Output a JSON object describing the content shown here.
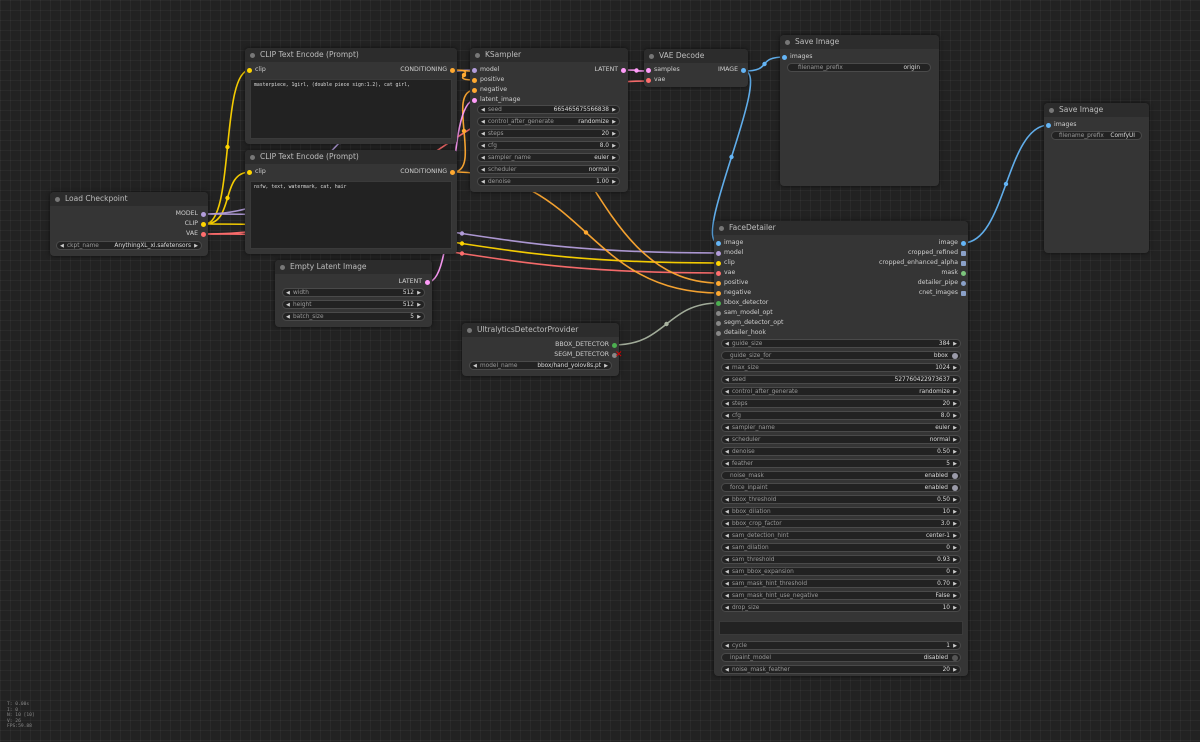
{
  "colors": {
    "model": "#b39ddb",
    "clip": "#ffd500",
    "vae": "#ff6e6e",
    "conditioning": "#ffa931",
    "latent": "#ff9cf9",
    "image": "#64b5f6",
    "bbox": "#4caf50",
    "generic": "#888888"
  },
  "load_checkpoint": {
    "title": "Load Checkpoint",
    "outputs": [
      "MODEL",
      "CLIP",
      "VAE"
    ],
    "ckpt_label": "ckpt_name",
    "ckpt_value": "AnythingXL_xl.safetensors"
  },
  "clip_pos": {
    "title": "CLIP Text Encode (Prompt)",
    "input": "clip",
    "output": "CONDITIONING",
    "text": "masterpiece, 1girl, (double piece sign:1.2), cat girl,"
  },
  "clip_neg": {
    "title": "CLIP Text Encode (Prompt)",
    "input": "clip",
    "output": "CONDITIONING",
    "text": "nsfw, text, watermark, cat, hair"
  },
  "empty_latent": {
    "title": "Empty Latent Image",
    "output": "LATENT",
    "widgets": [
      {
        "label": "width",
        "value": "512"
      },
      {
        "label": "height",
        "value": "512"
      },
      {
        "label": "batch_size",
        "value": "5"
      }
    ]
  },
  "ksampler": {
    "title": "KSampler",
    "inputs": [
      "model",
      "positive",
      "negative",
      "latent_image"
    ],
    "output": "LATENT",
    "widgets": [
      {
        "label": "seed",
        "value": "665465675566838"
      },
      {
        "label": "control_after_generate",
        "value": "randomize"
      },
      {
        "label": "steps",
        "value": "20"
      },
      {
        "label": "cfg",
        "value": "8.0"
      },
      {
        "label": "sampler_name",
        "value": "euler"
      },
      {
        "label": "scheduler",
        "value": "normal"
      },
      {
        "label": "denoise",
        "value": "1.00"
      }
    ]
  },
  "vae_decode": {
    "title": "VAE Decode",
    "inputs": [
      "samples",
      "vae"
    ],
    "output": "IMAGE"
  },
  "save1": {
    "title": "Save Image",
    "input": "images",
    "prefix_label": "filename_prefix",
    "prefix_value": "origin"
  },
  "save2": {
    "title": "Save Image",
    "input": "images",
    "prefix_label": "filename_prefix",
    "prefix_value": "ComfyUI"
  },
  "ultralytics": {
    "title": "UltralyticsDetectorProvider",
    "outputs": [
      "BBOX_DETECTOR",
      "SEGM_DETECTOR"
    ],
    "model_label": "model_name",
    "model_value": "bbox/hand_yolov8s.pt"
  },
  "face_detailer": {
    "title": "FaceDetailer",
    "inputs": [
      "image",
      "model",
      "clip",
      "vae",
      "positive",
      "negative",
      "bbox_detector",
      "sam_model_opt",
      "segm_detector_opt",
      "detailer_hook"
    ],
    "outputs": [
      "image",
      "cropped_refined",
      "cropped_enhanced_alpha",
      "mask",
      "detailer_pipe",
      "cnet_images"
    ],
    "widgets": [
      {
        "label": "guide_size",
        "value": "384",
        "kind": "num"
      },
      {
        "label": "guide_size_for",
        "value": "bbox",
        "kind": "toggle"
      },
      {
        "label": "max_size",
        "value": "1024",
        "kind": "num"
      },
      {
        "label": "seed",
        "value": "527760422973637",
        "kind": "num"
      },
      {
        "label": "control_after_generate",
        "value": "randomize",
        "kind": "num"
      },
      {
        "label": "steps",
        "value": "20",
        "kind": "num"
      },
      {
        "label": "cfg",
        "value": "8.0",
        "kind": "num"
      },
      {
        "label": "sampler_name",
        "value": "euler",
        "kind": "num"
      },
      {
        "label": "scheduler",
        "value": "normal",
        "kind": "num"
      },
      {
        "label": "denoise",
        "value": "0.50",
        "kind": "num"
      },
      {
        "label": "feather",
        "value": "5",
        "kind": "num"
      },
      {
        "label": "noise_mask",
        "value": "enabled",
        "kind": "toggle"
      },
      {
        "label": "force_inpaint",
        "value": "enabled",
        "kind": "toggle"
      },
      {
        "label": "bbox_threshold",
        "value": "0.50",
        "kind": "num"
      },
      {
        "label": "bbox_dilation",
        "value": "10",
        "kind": "num"
      },
      {
        "label": "bbox_crop_factor",
        "value": "3.0",
        "kind": "num"
      },
      {
        "label": "sam_detection_hint",
        "value": "center-1",
        "kind": "num"
      },
      {
        "label": "sam_dilation",
        "value": "0",
        "kind": "num"
      },
      {
        "label": "sam_threshold",
        "value": "0.93",
        "kind": "num"
      },
      {
        "label": "sam_bbox_expansion",
        "value": "0",
        "kind": "num"
      },
      {
        "label": "sam_mask_hint_threshold",
        "value": "0.70",
        "kind": "num"
      },
      {
        "label": "sam_mask_hint_use_negative",
        "value": "False",
        "kind": "num"
      },
      {
        "label": "drop_size",
        "value": "10",
        "kind": "num"
      }
    ],
    "widgets_bottom": [
      {
        "label": "cycle",
        "value": "1",
        "kind": "num"
      },
      {
        "label": "inpaint_model",
        "value": "disabled",
        "kind": "toggle-off"
      },
      {
        "label": "noise_mask_feather",
        "value": "20",
        "kind": "num"
      }
    ]
  },
  "stats": [
    "T: 0.00s",
    "I: 0",
    "N: 10 [10]",
    "V: 26",
    "FPS:59.88"
  ]
}
